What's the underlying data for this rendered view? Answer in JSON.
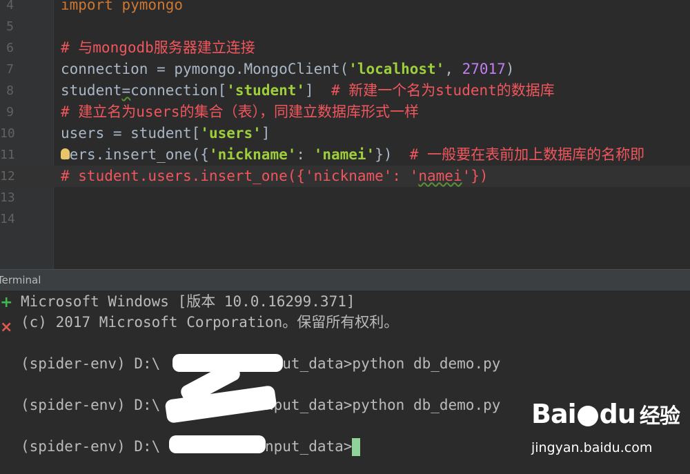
{
  "editor": {
    "lines": [
      {
        "n": "4",
        "tokens": [
          {
            "t": "import pymongo",
            "c": "kw"
          }
        ]
      },
      {
        "n": "5",
        "tokens": []
      },
      {
        "n": "6",
        "tokens": [
          {
            "t": "# 与mongodb服务器建立连接",
            "c": "cm"
          }
        ]
      },
      {
        "n": "7",
        "tokens": [
          {
            "t": "connection = pymongo.MongoClient(",
            "c": ""
          },
          {
            "t": "'localhost'",
            "c": "str"
          },
          {
            "t": ", ",
            "c": ""
          },
          {
            "t": "27017",
            "c": "num"
          },
          {
            "t": ")",
            "c": ""
          }
        ]
      },
      {
        "n": "8",
        "tokens": [
          {
            "t": "student",
            "c": ""
          },
          {
            "t": "=",
            "c": "u"
          },
          {
            "t": "connection[",
            "c": ""
          },
          {
            "t": "'student'",
            "c": "str"
          },
          {
            "t": "]  ",
            "c": ""
          },
          {
            "t": "# 新建一个名为student的数据库",
            "c": "cm"
          }
        ]
      },
      {
        "n": "9",
        "tokens": [
          {
            "t": "# 建立名为users的集合（表），同建立数据库形式一样",
            "c": "cm"
          }
        ]
      },
      {
        "n": "10",
        "tokens": [
          {
            "t": "users = student[",
            "c": ""
          },
          {
            "t": "'users'",
            "c": "str"
          },
          {
            "t": "]",
            "c": ""
          }
        ]
      },
      {
        "n": "11",
        "tokens": [
          {
            "t": "u",
            "c": "bulb"
          },
          {
            "t": "ers.insert_one({",
            "c": ""
          },
          {
            "t": "'nickname'",
            "c": "str"
          },
          {
            "t": ": ",
            "c": ""
          },
          {
            "t": "'namei'",
            "c": "str"
          },
          {
            "t": "})  ",
            "c": ""
          },
          {
            "t": "# 一般要在表前加上数据库的名称即",
            "c": "cm"
          }
        ]
      },
      {
        "n": "12",
        "tokens": [
          {
            "t": "# student.users.insert_one({'nickname': '",
            "c": "cm"
          },
          {
            "t": "namei",
            "c": "cm u"
          },
          {
            "t": "'})",
            "c": "cm"
          }
        ]
      },
      {
        "n": "13",
        "tokens": []
      },
      {
        "n": "14",
        "tokens": []
      }
    ]
  },
  "terminal": {
    "title": "Terminal",
    "add_icon": "plus-icon",
    "close_icon": "close-icon",
    "lines": [
      "Microsoft Windows [版本 10.0.16299.371]",
      "(c) 2017 Microsoft Corporation。保留所有权利。",
      "",
      "(spider-env) D:\\          \\input_data>python db_demo.py",
      "",
      "(spider-env) D:\\          \\input_data>python db_demo.py",
      "",
      "(spider-env) D:\\          \\input_data>"
    ]
  },
  "watermark": {
    "logo_text": "Bai",
    "logo_text2": "du",
    "logo_cn": "经验",
    "url": "jingyan.baidu.com"
  },
  "colors": {
    "comment": "#f0565d",
    "string": "#9ece3b",
    "number": "#c07ff5",
    "cursor": "#8fd39a"
  }
}
